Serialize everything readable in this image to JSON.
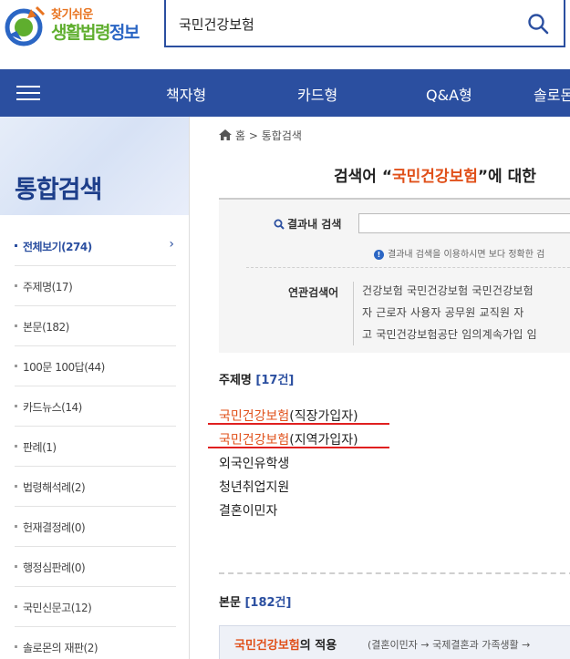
{
  "header": {
    "logo_small": "찾기쉬운",
    "logo_green": "생활법령",
    "logo_blue": "정보",
    "search_value": "국민건강보험"
  },
  "nav": {
    "items": [
      "책자형",
      "카드형",
      "Q&A형",
      "솔로몬"
    ]
  },
  "sidebar": {
    "title": "통합검색",
    "items": [
      {
        "label": "전체보기(274)",
        "active": true
      },
      {
        "label": "주제명(17)"
      },
      {
        "label": "본문(182)"
      },
      {
        "label": "100문 100답(44)"
      },
      {
        "label": "카드뉴스(14)"
      },
      {
        "label": "판례(1)"
      },
      {
        "label": "법령해석례(2)"
      },
      {
        "label": "헌재결정례(0)"
      },
      {
        "label": "행정심판례(0)"
      },
      {
        "label": "국민신문고(12)"
      },
      {
        "label": "솔로몬의 재판(2)"
      }
    ]
  },
  "main": {
    "breadcrumb_home": "홈",
    "breadcrumb_sep": ">",
    "breadcrumb_current": "통합검색",
    "result_prefix": "검색어 “",
    "result_keyword": "국민건강보험",
    "result_suffix": "”에 대한",
    "filter_label": "결과내 검색",
    "filter_note": "결과내 검색을 이용하시면 보다 정확한 검",
    "related_label": "연관검색어",
    "related_lines": [
      "건강보험  국민건강보험  국민건강보험",
      "자  근로자  사용자  공무원  교직원  자",
      "고  국민건강보험공단  임의계속가입  임"
    ],
    "topics_head": "주제명",
    "topics_count": "[17건]",
    "topics": [
      {
        "kw": "국민건강보험",
        "rest": "(직장가입자)"
      },
      {
        "kw": "국민건강보험",
        "rest": "(지역가입자)"
      },
      {
        "kw": "",
        "rest": "외국인유학생"
      },
      {
        "kw": "",
        "rest": "청년취업지원"
      },
      {
        "kw": "",
        "rest": "결혼이민자"
      }
    ],
    "body_head": "본문",
    "body_count": "[182건]",
    "body_row_kw": "국민건강보험",
    "body_row_rest": "의 적용",
    "body_row_sub": "(결혼이민자 → 국제결혼과 가족생활 →"
  }
}
